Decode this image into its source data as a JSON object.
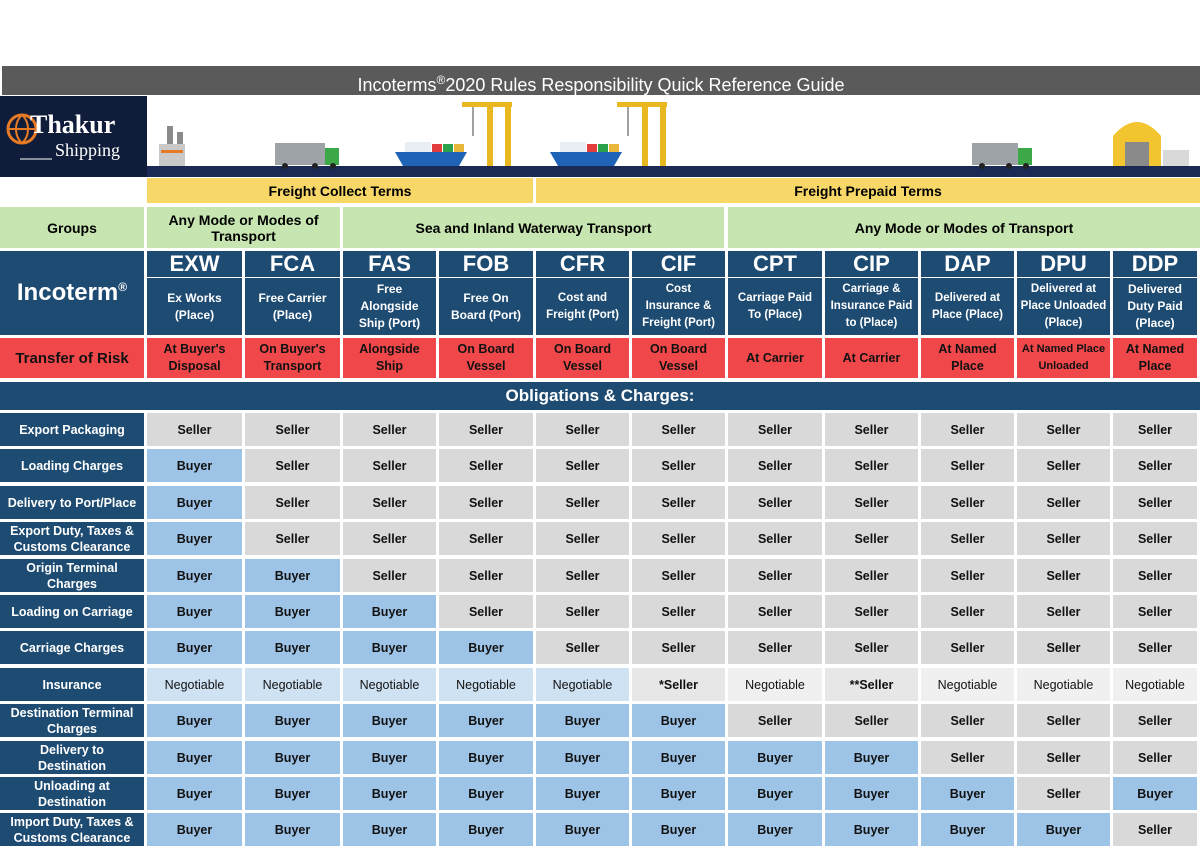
{
  "title": {
    "main": "Incoterms",
    "sup": "®",
    "rest": "2020 Rules Responsibility Quick Reference Guide"
  },
  "logo": {
    "name": "Thakur",
    "sub": "Shipping"
  },
  "freight": {
    "collect": "Freight Collect Terms",
    "prepaid": "Freight Prepaid Terms"
  },
  "groups": {
    "label": "Groups",
    "any_mode_1": "Any Mode or Modes of Transport",
    "sea": "Sea and Inland Waterway Transport",
    "any_mode_2": "Any Mode or Modes of Transport"
  },
  "incoterm_label": {
    "text": "Incoterm",
    "sup": "®"
  },
  "risk_label": "Transfer of Risk",
  "obligations_title": "Obligations & Charges:",
  "terms": [
    {
      "code": "EXW",
      "desc": [
        "Ex Works",
        "(Place)"
      ],
      "risk": [
        "At Buyer's",
        "Disposal"
      ]
    },
    {
      "code": "FCA",
      "desc": [
        "Free Carrier",
        "(Place)"
      ],
      "risk": [
        "On Buyer's",
        "Transport"
      ]
    },
    {
      "code": "FAS",
      "desc": [
        "Free",
        "Alongside",
        "Ship (Port)"
      ],
      "risk": [
        "Alongside",
        "Ship"
      ]
    },
    {
      "code": "FOB",
      "desc": [
        "Free On",
        "Board (Port)"
      ],
      "risk": [
        "On Board",
        "Vessel"
      ]
    },
    {
      "code": "CFR",
      "desc": [
        "Cost and",
        "Freight (Port)"
      ],
      "risk": [
        "On Board",
        "Vessel"
      ]
    },
    {
      "code": "CIF",
      "desc": [
        "Cost",
        "Insurance &",
        "Freight (Port)"
      ],
      "risk": [
        "On Board",
        "Vessel"
      ]
    },
    {
      "code": "CPT",
      "desc": [
        "Carriage Paid",
        "To (Place)"
      ],
      "risk": [
        "At Carrier"
      ]
    },
    {
      "code": "CIP",
      "desc": [
        "Carriage &",
        "Insurance Paid",
        "to (Place)"
      ],
      "risk": [
        "At Carrier"
      ]
    },
    {
      "code": "DAP",
      "desc": [
        "Delivered at",
        "Place (Place)"
      ],
      "risk": [
        "At Named",
        "Place"
      ]
    },
    {
      "code": "DPU",
      "desc": [
        "Delivered at",
        "Place Unloaded",
        "(Place)"
      ],
      "risk": [
        "At Named Place",
        "Unloaded"
      ]
    },
    {
      "code": "DDP",
      "desc": [
        "Delivered",
        "Duty Paid",
        "(Place)"
      ],
      "risk": [
        "At Named",
        "Place"
      ]
    }
  ],
  "rows": [
    {
      "label": [
        "Export Packaging"
      ],
      "values": [
        "Seller",
        "Seller",
        "Seller",
        "Seller",
        "Seller",
        "Seller",
        "Seller",
        "Seller",
        "Seller",
        "Seller",
        "Seller"
      ]
    },
    {
      "label": [
        "Loading Charges"
      ],
      "values": [
        "Buyer",
        "Seller",
        "Seller",
        "Seller",
        "Seller",
        "Seller",
        "Seller",
        "Seller",
        "Seller",
        "Seller",
        "Seller"
      ]
    },
    {
      "label": [
        "Delivery to Port/Place"
      ],
      "values": [
        "Buyer",
        "Seller",
        "Seller",
        "Seller",
        "Seller",
        "Seller",
        "Seller",
        "Seller",
        "Seller",
        "Seller",
        "Seller"
      ]
    },
    {
      "label": [
        "Export Duty, Taxes &",
        "Customs Clearance"
      ],
      "values": [
        "Buyer",
        "Seller",
        "Seller",
        "Seller",
        "Seller",
        "Seller",
        "Seller",
        "Seller",
        "Seller",
        "Seller",
        "Seller"
      ]
    },
    {
      "label": [
        "Origin Terminal",
        "Charges"
      ],
      "values": [
        "Buyer",
        "Buyer",
        "Seller",
        "Seller",
        "Seller",
        "Seller",
        "Seller",
        "Seller",
        "Seller",
        "Seller",
        "Seller"
      ]
    },
    {
      "label": [
        "Loading on Carriage"
      ],
      "values": [
        "Buyer",
        "Buyer",
        "Buyer",
        "Seller",
        "Seller",
        "Seller",
        "Seller",
        "Seller",
        "Seller",
        "Seller",
        "Seller"
      ]
    },
    {
      "label": [
        "Carriage Charges"
      ],
      "values": [
        "Buyer",
        "Buyer",
        "Buyer",
        "Buyer",
        "Seller",
        "Seller",
        "Seller",
        "Seller",
        "Seller",
        "Seller",
        "Seller"
      ]
    },
    {
      "label": [
        "Insurance"
      ],
      "values": [
        "Negotiable",
        "Negotiable",
        "Negotiable",
        "Negotiable",
        "Negotiable",
        "*Seller",
        "Negotiable",
        "**Seller",
        "Negotiable",
        "Negotiable",
        "Negotiable"
      ]
    },
    {
      "label": [
        "Destination Terminal",
        "Charges"
      ],
      "values": [
        "Buyer",
        "Buyer",
        "Buyer",
        "Buyer",
        "Buyer",
        "Buyer",
        "Seller",
        "Seller",
        "Seller",
        "Seller",
        "Seller"
      ]
    },
    {
      "label": [
        "Delivery to",
        "Destination"
      ],
      "values": [
        "Buyer",
        "Buyer",
        "Buyer",
        "Buyer",
        "Buyer",
        "Buyer",
        "Buyer",
        "Buyer",
        "Seller",
        "Seller",
        "Seller"
      ]
    },
    {
      "label": [
        "Unloading at",
        "Destination"
      ],
      "values": [
        "Buyer",
        "Buyer",
        "Buyer",
        "Buyer",
        "Buyer",
        "Buyer",
        "Buyer",
        "Buyer",
        "Buyer",
        "Seller",
        "Buyer"
      ]
    },
    {
      "label": [
        "Import Duty, Taxes &",
        "Customs Clearance"
      ],
      "values": [
        "Buyer",
        "Buyer",
        "Buyer",
        "Buyer",
        "Buyer",
        "Buyer",
        "Buyer",
        "Buyer",
        "Buyer",
        "Buyer",
        "Seller"
      ]
    }
  ],
  "colors": {
    "navy": "#1e4b72",
    "yellow": "#f7d768",
    "green": "#c7e5b0",
    "red": "#f0484a",
    "seller": "#d9d9d9",
    "buyer": "#9dc3e6"
  }
}
